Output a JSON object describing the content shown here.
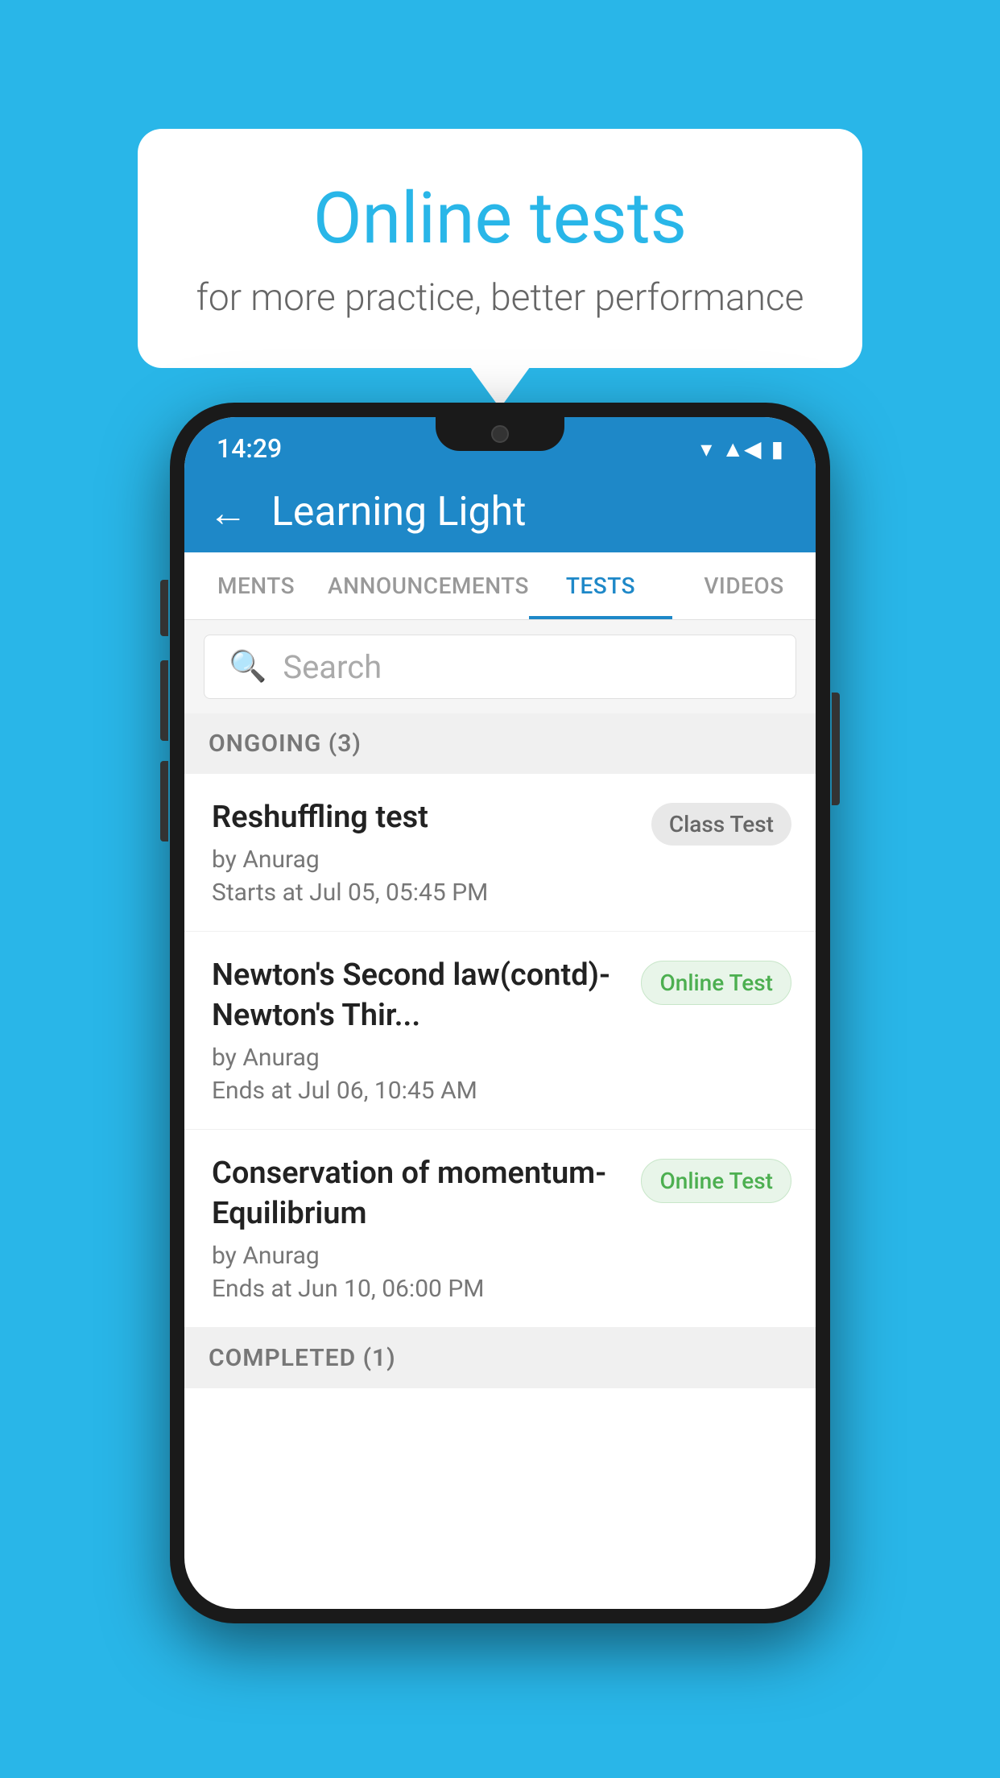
{
  "background_color": "#29b6e8",
  "speech_bubble": {
    "title": "Online tests",
    "subtitle": "for more practice, better performance"
  },
  "phone": {
    "status_bar": {
      "time": "14:29",
      "icons": [
        "wifi",
        "signal",
        "battery"
      ]
    },
    "header": {
      "back_label": "←",
      "title": "Learning Light"
    },
    "tabs": [
      {
        "label": "MENTS",
        "active": false
      },
      {
        "label": "ANNOUNCEMENTS",
        "active": false
      },
      {
        "label": "TESTS",
        "active": true
      },
      {
        "label": "VIDEOS",
        "active": false
      }
    ],
    "search": {
      "placeholder": "Search"
    },
    "sections": [
      {
        "title": "ONGOING (3)",
        "tests": [
          {
            "name": "Reshuffling test",
            "author": "by Anurag",
            "time": "Starts at  Jul 05, 05:45 PM",
            "badge": "Class Test",
            "badge_type": "class"
          },
          {
            "name": "Newton's Second law(contd)-Newton's Thir...",
            "author": "by Anurag",
            "time": "Ends at  Jul 06, 10:45 AM",
            "badge": "Online Test",
            "badge_type": "online"
          },
          {
            "name": "Conservation of momentum-Equilibrium",
            "author": "by Anurag",
            "time": "Ends at  Jun 10, 06:00 PM",
            "badge": "Online Test",
            "badge_type": "online"
          }
        ]
      },
      {
        "title": "COMPLETED (1)",
        "tests": []
      }
    ]
  }
}
